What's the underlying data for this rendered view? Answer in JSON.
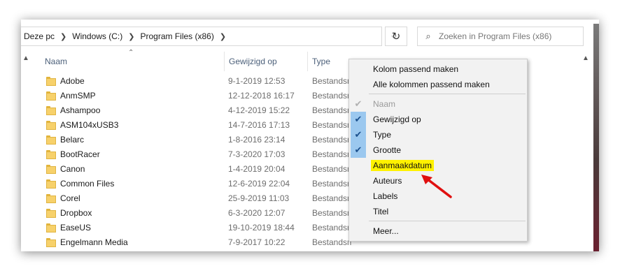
{
  "breadcrumb": {
    "items": [
      "Deze pc",
      "Windows (C:)",
      "Program Files (x86)"
    ]
  },
  "search": {
    "placeholder": "Zoeken in Program Files (x86)"
  },
  "columns": {
    "name": "Naam",
    "modified": "Gewijzigd op",
    "type": "Type"
  },
  "rows": [
    {
      "name": "Adobe",
      "date": "9-1-2019 12:53",
      "type": "Bestandsmap"
    },
    {
      "name": "AnmSMP",
      "date": "12-12-2018 16:17",
      "type": "Bestandsmap"
    },
    {
      "name": "Ashampoo",
      "date": "4-12-2019 15:22",
      "type": "Bestandsmap"
    },
    {
      "name": "ASM104xUSB3",
      "date": "14-7-2016 17:13",
      "type": "Bestandsmap"
    },
    {
      "name": "Belarc",
      "date": "1-8-2016 23:14",
      "type": "Bestandsmap"
    },
    {
      "name": "BootRacer",
      "date": "7-3-2020 17:03",
      "type": "Bestandsmap"
    },
    {
      "name": "Canon",
      "date": "1-4-2019 20:04",
      "type": "Bestandsmap"
    },
    {
      "name": "Common Files",
      "date": "12-6-2019 22:04",
      "type": "Bestandsmap"
    },
    {
      "name": "Corel",
      "date": "25-9-2019 11:03",
      "type": "Bestandsmap"
    },
    {
      "name": "Dropbox",
      "date": "6-3-2020 12:07",
      "type": "Bestandsmap"
    },
    {
      "name": "EaseUS",
      "date": "19-10-2019 18:44",
      "type": "Bestandsmap"
    },
    {
      "name": "Engelmann Media",
      "date": "7-9-2017 10:22",
      "type": "Bestandsmap"
    }
  ],
  "menu": {
    "fit_column": "Kolom passend maken",
    "fit_all": "Alle kolommen passend maken",
    "naam": "Naam",
    "gewijzigd": "Gewijzigd op",
    "type": "Type",
    "grootte": "Grootte",
    "aanmaakdatum": "Aanmaakdatum",
    "auteurs": "Auteurs",
    "labels": "Labels",
    "titel": "Titel",
    "meer": "Meer..."
  },
  "colors": {
    "highlight": "#fff200",
    "check_bg": "#9bc8ef",
    "arrow": "#e01010"
  }
}
